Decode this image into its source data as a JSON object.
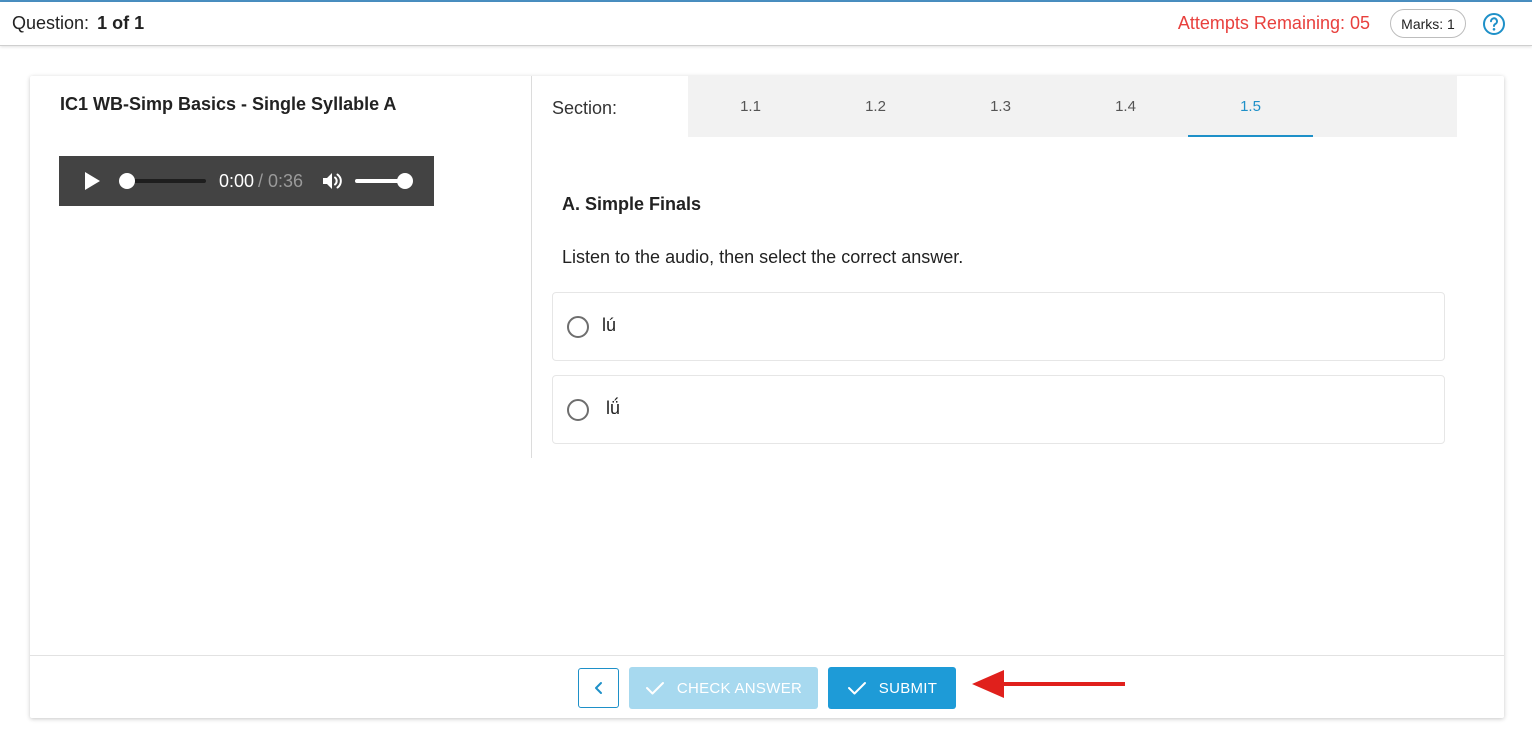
{
  "header": {
    "question_label": "Question:",
    "question_value": "1 of 1",
    "attempts": "Attempts Remaining: 05",
    "marks": "Marks: 1",
    "help_icon": "help-circle-icon"
  },
  "left_panel": {
    "title": "IC1 WB-Simp Basics - Single Syllable A",
    "audio": {
      "current_time": "0:00",
      "duration_text": "/ 0:36",
      "progress": 0,
      "volume": 1.0
    }
  },
  "right_panel": {
    "section_label": "Section:",
    "tabs": [
      {
        "label": "1.1"
      },
      {
        "label": "1.2"
      },
      {
        "label": "1.3"
      },
      {
        "label": "1.4"
      },
      {
        "label": "1.5"
      }
    ],
    "active_tab": "1.5",
    "part_title": "A. Simple Finals",
    "instruction": "Listen to the audio, then select the correct answer.",
    "options": [
      {
        "text": "lú",
        "selected": false
      },
      {
        "text": "lǘ",
        "selected": false
      }
    ]
  },
  "footer": {
    "check_answer_label": "CHECK ANSWER",
    "submit_label": "SUBMIT"
  },
  "colors": {
    "accent": "#1e9bd7",
    "accent_disabled": "#a7d9ef",
    "attempts_red": "#e8403d",
    "arrow_red": "#e0201c"
  }
}
